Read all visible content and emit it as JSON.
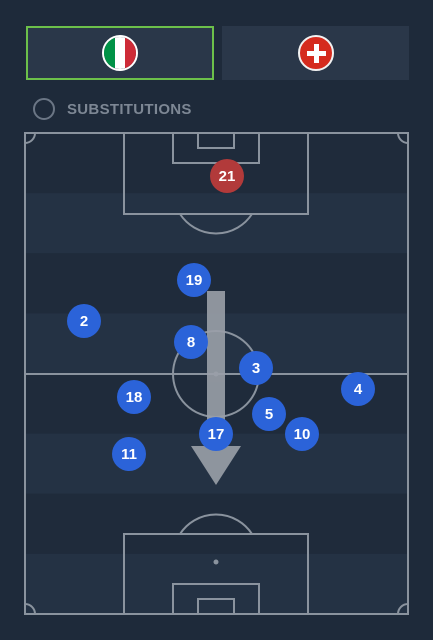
{
  "colors": {
    "background": "#1e2a3a",
    "pitch_stripe_dark": "#1f2b3b",
    "pitch_stripe_light": "#243244",
    "pitch_lines": "#8a939e",
    "selected_tab_border": "#6cc04a",
    "home_player": "#2b63d9",
    "away_player": "#b23a3a",
    "arrow": "#9aa0a8"
  },
  "tabs": [
    {
      "team": "Italy",
      "flag_icon": "italy-flag-icon",
      "selected": true
    },
    {
      "team": "Switzerland",
      "flag_icon": "switzerland-flag-icon",
      "selected": false
    }
  ],
  "substitutions": {
    "label": "SUBSTITUTIONS",
    "checked": false
  },
  "players": {
    "home": [
      {
        "number": "19"
      },
      {
        "number": "2"
      },
      {
        "number": "8"
      },
      {
        "number": "3"
      },
      {
        "number": "18"
      },
      {
        "number": "4"
      },
      {
        "number": "5"
      },
      {
        "number": "17"
      },
      {
        "number": "10"
      },
      {
        "number": "11"
      }
    ],
    "away": [
      {
        "number": "21"
      }
    ]
  }
}
